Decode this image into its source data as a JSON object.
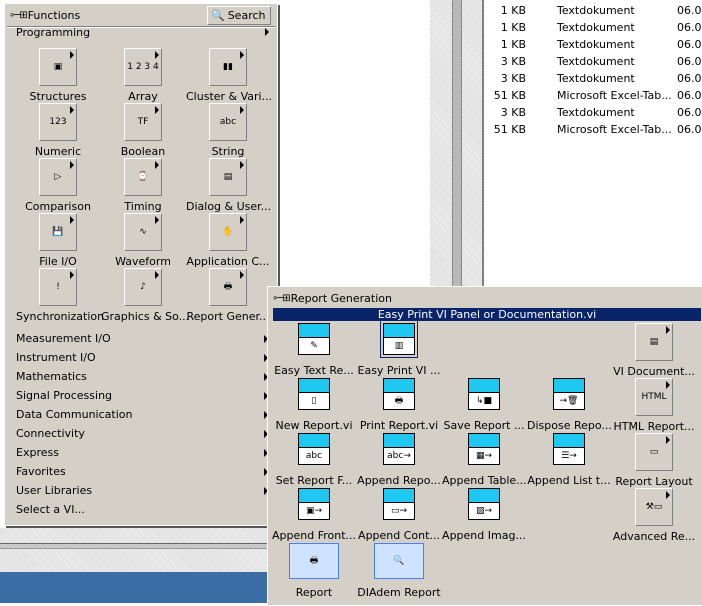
{
  "file_list": {
    "rows": [
      {
        "size": "1 KB",
        "type": "Textdokument",
        "date": "06.0"
      },
      {
        "size": "1 KB",
        "type": "Textdokument",
        "date": "06.0"
      },
      {
        "size": "1 KB",
        "type": "Textdokument",
        "date": "06.0"
      },
      {
        "size": "3 KB",
        "type": "Textdokument",
        "date": "06.0"
      },
      {
        "size": "3 KB",
        "type": "Textdokument",
        "date": "06.0"
      },
      {
        "size": "51 KB",
        "type": "Microsoft Excel-Tab...",
        "date": "06.0"
      },
      {
        "size": "3 KB",
        "type": "Textdokument",
        "date": "06.0"
      },
      {
        "size": "51 KB",
        "type": "Microsoft Excel-Tab...",
        "date": "06.0"
      }
    ]
  },
  "functions_palette": {
    "title": "Functions",
    "search_label": "Search",
    "section": "Programming",
    "items": [
      {
        "label": "Structures",
        "icon": "structures-icon",
        "glyph": "▣"
      },
      {
        "label": "Array",
        "icon": "array-icon",
        "glyph": "1 2 3 4"
      },
      {
        "label": "Cluster & Vari...",
        "icon": "cluster-icon",
        "glyph": "▮▮"
      },
      {
        "label": "Numeric",
        "icon": "numeric-icon",
        "glyph": "123"
      },
      {
        "label": "Boolean",
        "icon": "boolean-icon",
        "glyph": "TF"
      },
      {
        "label": "String",
        "icon": "string-icon",
        "glyph": "abc"
      },
      {
        "label": "Comparison",
        "icon": "comparison-icon",
        "glyph": "▷"
      },
      {
        "label": "Timing",
        "icon": "watch-icon",
        "glyph": "⌚"
      },
      {
        "label": "Dialog & User...",
        "icon": "dialog-icon",
        "glyph": "▤"
      },
      {
        "label": "File I/O",
        "icon": "floppy-icon",
        "glyph": "💾"
      },
      {
        "label": "Waveform",
        "icon": "waveform-icon",
        "glyph": "∿"
      },
      {
        "label": "Application C...",
        "icon": "application-control-icon",
        "glyph": "✋"
      },
      {
        "label": "Synchronization",
        "icon": "traffic-light-icon",
        "glyph": "!"
      },
      {
        "label": "Graphics & So...",
        "icon": "graphics-sound-icon",
        "glyph": "♪"
      },
      {
        "label": "Report Gener...",
        "icon": "report-generation-icon",
        "glyph": "🖶"
      }
    ],
    "categories": [
      "Measurement I/O",
      "Instrument I/O",
      "Mathematics",
      "Signal Processing",
      "Data Communication",
      "Connectivity",
      "Express",
      "Favorites",
      "User Libraries",
      "Select a VI..."
    ]
  },
  "report_palette": {
    "title": "Report Generation",
    "tooltip": "Easy Print VI Panel or Documentation.vi",
    "items": [
      {
        "label": "Easy Text Re...",
        "icon": "pen-icon",
        "glyph": "✎",
        "col": 0,
        "row": 0,
        "kind": "vi"
      },
      {
        "label": "Easy Print VI ...",
        "icon": "print-panel-icon",
        "glyph": "▥",
        "col": 1,
        "row": 0,
        "kind": "vi",
        "selected": true
      },
      {
        "label": "VI Document...",
        "icon": "vi-documentation-icon",
        "glyph": "▤",
        "col": 4,
        "row": 0,
        "kind": "sub"
      },
      {
        "label": "New Report.vi",
        "icon": "new-report-icon",
        "glyph": "▯",
        "col": 0,
        "row": 1,
        "kind": "vi"
      },
      {
        "label": "Print Report.vi",
        "icon": "print-report-icon",
        "glyph": "🖶",
        "col": 1,
        "row": 1,
        "kind": "vi"
      },
      {
        "label": "Save Report ...",
        "icon": "save-report-icon",
        "glyph": "↳■",
        "col": 2,
        "row": 1,
        "kind": "vi"
      },
      {
        "label": "Dispose Repo...",
        "icon": "dispose-report-icon",
        "glyph": "→🗑",
        "col": 3,
        "row": 1,
        "kind": "vi"
      },
      {
        "label": "HTML Report...",
        "icon": "html-icon",
        "glyph": "HTML",
        "col": 4,
        "row": 1,
        "kind": "sub"
      },
      {
        "label": "Set Report F...",
        "icon": "set-font-icon",
        "glyph": "abc",
        "col": 0,
        "row": 2,
        "kind": "vi"
      },
      {
        "label": "Append Repo...",
        "icon": "append-text-icon",
        "glyph": "abc→",
        "col": 1,
        "row": 2,
        "kind": "vi"
      },
      {
        "label": "Append Table...",
        "icon": "append-table-icon",
        "glyph": "▦→",
        "col": 2,
        "row": 2,
        "kind": "vi"
      },
      {
        "label": "Append List t...",
        "icon": "append-list-icon",
        "glyph": "☰→",
        "col": 3,
        "row": 2,
        "kind": "vi"
      },
      {
        "label": "Report Layout",
        "icon": "report-layout-icon",
        "glyph": "▭",
        "col": 4,
        "row": 2,
        "kind": "sub"
      },
      {
        "label": "Append Front...",
        "icon": "append-front-panel-icon",
        "glyph": "▣→",
        "col": 0,
        "row": 3,
        "kind": "vi"
      },
      {
        "label": "Append Cont...",
        "icon": "append-control-icon",
        "glyph": "▭→",
        "col": 1,
        "row": 3,
        "kind": "vi"
      },
      {
        "label": "Append Imag...",
        "icon": "append-image-icon",
        "glyph": "▨→",
        "col": 2,
        "row": 3,
        "kind": "vi"
      },
      {
        "label": "Advanced Re...",
        "icon": "hammer-icon",
        "glyph": "⚒▭",
        "col": 4,
        "row": 3,
        "kind": "sub"
      },
      {
        "label": "Report",
        "icon": "printer-icon",
        "glyph": "🖶",
        "col": 0,
        "row": 4,
        "kind": "big"
      },
      {
        "label": "DIAdem Report",
        "icon": "diadem-icon",
        "glyph": "🔍",
        "col": 1,
        "row": 4,
        "kind": "big"
      }
    ]
  }
}
